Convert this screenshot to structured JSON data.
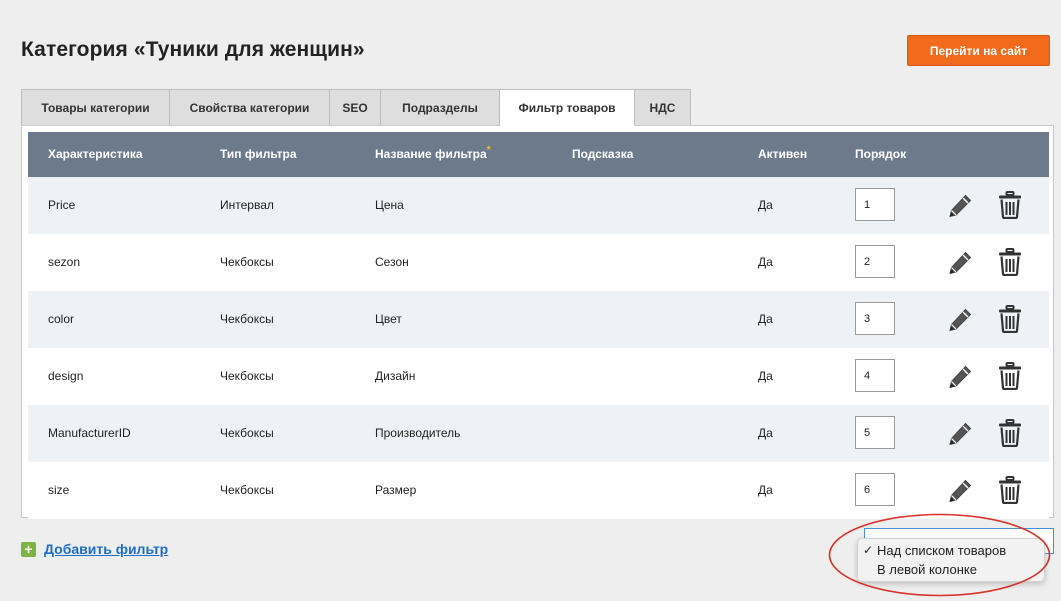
{
  "page": {
    "title": "Категория «Туники для женщин»",
    "site_button_label": "Перейти на сайт"
  },
  "tabs": [
    {
      "label": "Товары категории",
      "active": false
    },
    {
      "label": "Свойства категории",
      "active": false
    },
    {
      "label": "SEO",
      "active": false
    },
    {
      "label": "Подразделы",
      "active": false
    },
    {
      "label": "Фильтр товаров",
      "active": true
    },
    {
      "label": "НДС",
      "active": false
    }
  ],
  "table": {
    "headers": {
      "characteristic": "Характеристика",
      "filter_type": "Тип фильтра",
      "filter_name": "Название фильтра",
      "required_mark": "*",
      "hint": "Подсказка",
      "active": "Активен",
      "order": "Порядок"
    },
    "rows": [
      {
        "characteristic": "Price",
        "filter_type": "Интервал",
        "filter_name": "Цена",
        "hint": "",
        "active": "Да",
        "order": "1"
      },
      {
        "characteristic": "sezon",
        "filter_type": "Чекбоксы",
        "filter_name": "Сезон",
        "hint": "",
        "active": "Да",
        "order": "2"
      },
      {
        "characteristic": "color",
        "filter_type": "Чекбоксы",
        "filter_name": "Цвет",
        "hint": "",
        "active": "Да",
        "order": "3"
      },
      {
        "characteristic": "design",
        "filter_type": "Чекбоксы",
        "filter_name": "Дизайн",
        "hint": "",
        "active": "Да",
        "order": "4"
      },
      {
        "characteristic": "ManufacturerID",
        "filter_type": "Чекбоксы",
        "filter_name": "Производитель",
        "hint": "",
        "active": "Да",
        "order": "5"
      },
      {
        "characteristic": "size",
        "filter_type": "Чекбоксы",
        "filter_name": "Размер",
        "hint": "",
        "active": "Да",
        "order": "6"
      }
    ]
  },
  "footer": {
    "add_filter_label": "Добавить фильтр",
    "add_icon_glyph": "+",
    "position_options": [
      {
        "label": "Над списком товаров",
        "selected": true
      },
      {
        "label": "В левой колонке",
        "selected": false
      }
    ],
    "check_glyph": "✓"
  },
  "colors": {
    "accent_button": "#f26a1b",
    "table_header": "#6d7a8b",
    "row_alt": "#eef2f7",
    "link": "#1e6ec8",
    "add_icon": "#7cb342",
    "highlight": "#d9322a"
  },
  "icons": {
    "edit": "pencil-icon",
    "delete": "trash-icon",
    "add": "plus-icon"
  }
}
